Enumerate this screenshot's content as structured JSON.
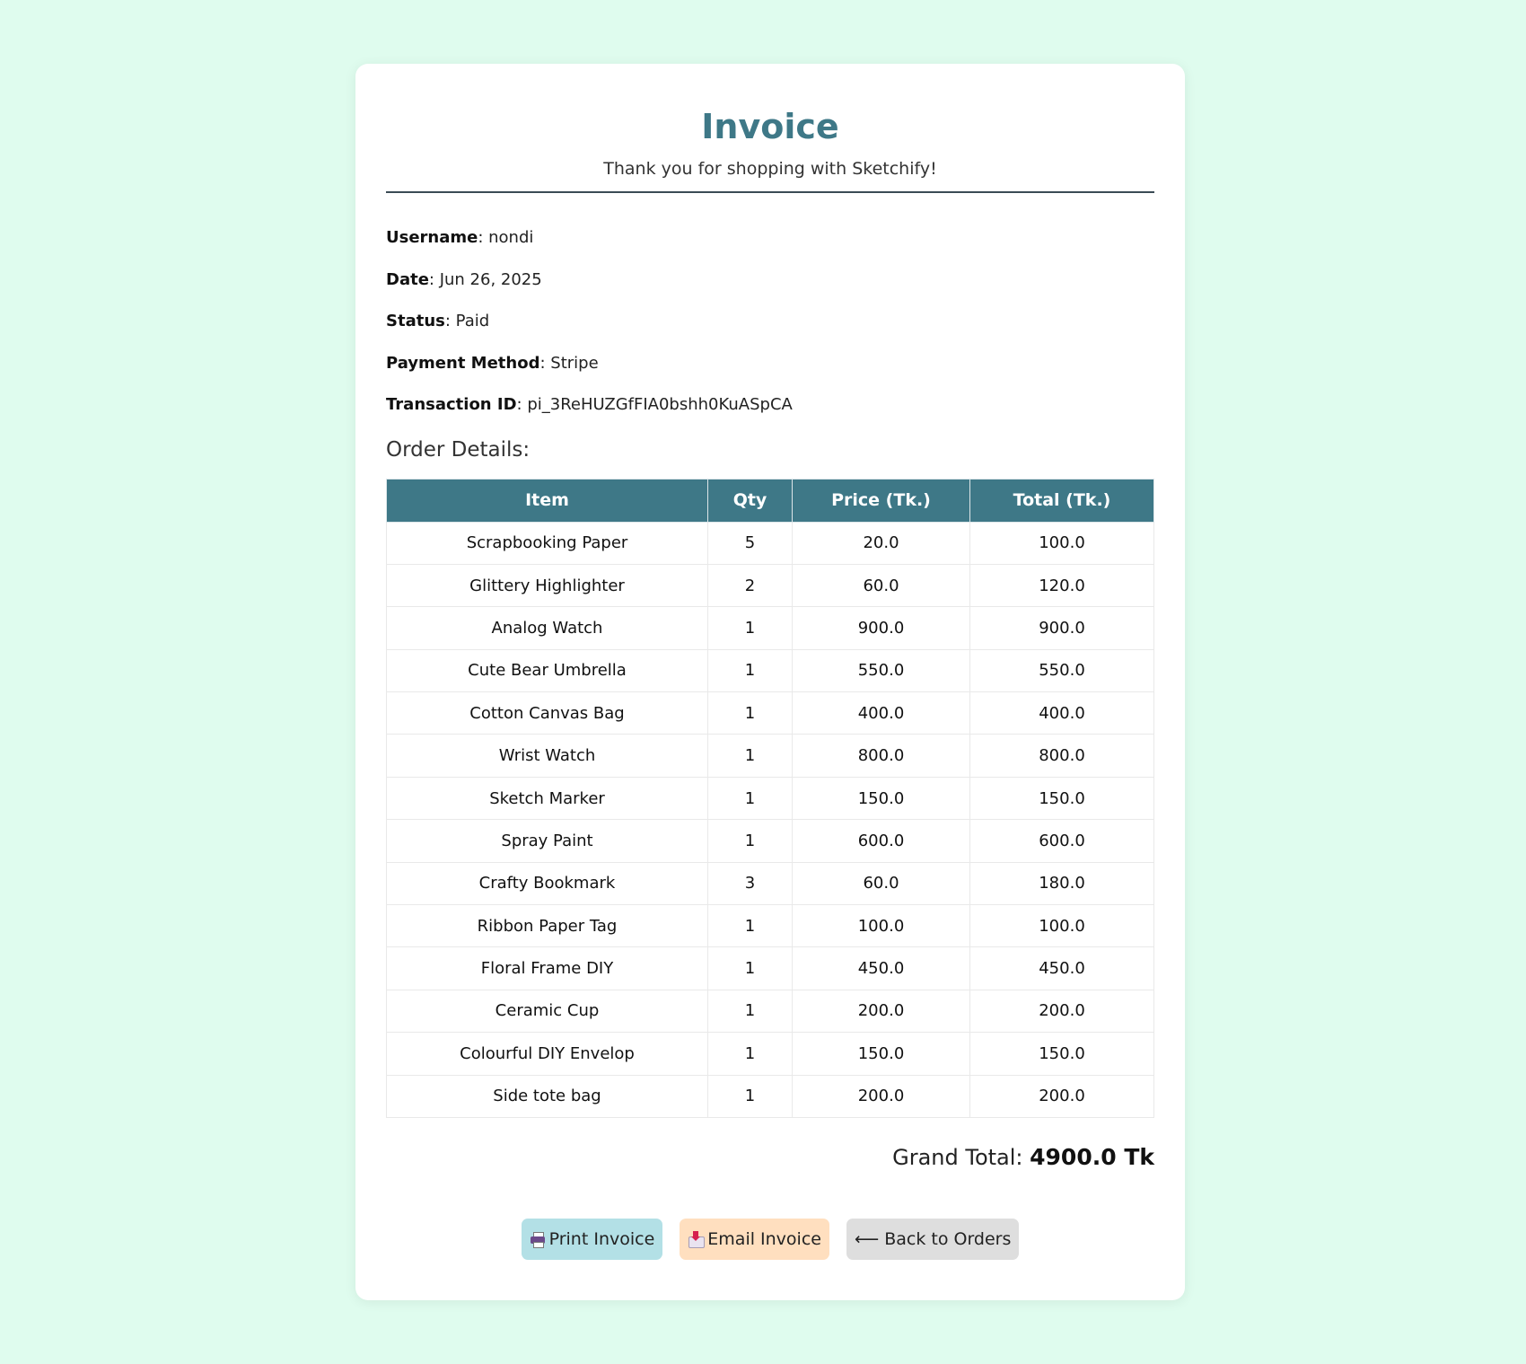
{
  "header": {
    "title": "Invoice",
    "subtitle": "Thank you for shopping with Sketchify!"
  },
  "meta": {
    "username_label": "Username",
    "username": "nondi",
    "date_label": "Date",
    "date": "Jun 26, 2025",
    "status_label": "Status",
    "status": "Paid",
    "payment_label": "Payment Method",
    "payment": "Stripe",
    "txn_label": "Transaction ID",
    "txn": "pi_3ReHUZGfFIA0bshh0KuASpCA"
  },
  "order": {
    "section_title": "Order Details:",
    "columns": [
      "Item",
      "Qty",
      "Price (Tk.)",
      "Total (Tk.)"
    ],
    "rows": [
      [
        "Scrapbooking Paper",
        "5",
        "20.0",
        "100.0"
      ],
      [
        "Glittery Highlighter",
        "2",
        "60.0",
        "120.0"
      ],
      [
        "Analog Watch",
        "1",
        "900.0",
        "900.0"
      ],
      [
        "Cute Bear Umbrella",
        "1",
        "550.0",
        "550.0"
      ],
      [
        "Cotton Canvas Bag",
        "1",
        "400.0",
        "400.0"
      ],
      [
        "Wrist Watch",
        "1",
        "800.0",
        "800.0"
      ],
      [
        "Sketch Marker",
        "1",
        "150.0",
        "150.0"
      ],
      [
        "Spray Paint",
        "1",
        "600.0",
        "600.0"
      ],
      [
        "Crafty Bookmark",
        "3",
        "60.0",
        "180.0"
      ],
      [
        "Ribbon Paper Tag",
        "1",
        "100.0",
        "100.0"
      ],
      [
        "Floral Frame DIY",
        "1",
        "450.0",
        "450.0"
      ],
      [
        "Ceramic Cup",
        "1",
        "200.0",
        "200.0"
      ],
      [
        "Colourful DIY Envelop",
        "1",
        "150.0",
        "150.0"
      ],
      [
        "Side tote bag",
        "1",
        "200.0",
        "200.0"
      ]
    ],
    "grand_total_label": "Grand Total:",
    "grand_total_value": "4900.0 Tk"
  },
  "actions": {
    "print_label": "Print Invoice",
    "print_icon": "printer-icon",
    "email_label": "Email Invoice",
    "email_icon": "inbox-tray-icon",
    "back_arrow": "⟵",
    "back_label": "Back to Orders"
  },
  "colors": {
    "page_bg": "#dffcee",
    "accent": "#3e7887",
    "print_button": "#b3e0e6",
    "email_button": "#ffdfbf",
    "back_button": "#dedede"
  }
}
